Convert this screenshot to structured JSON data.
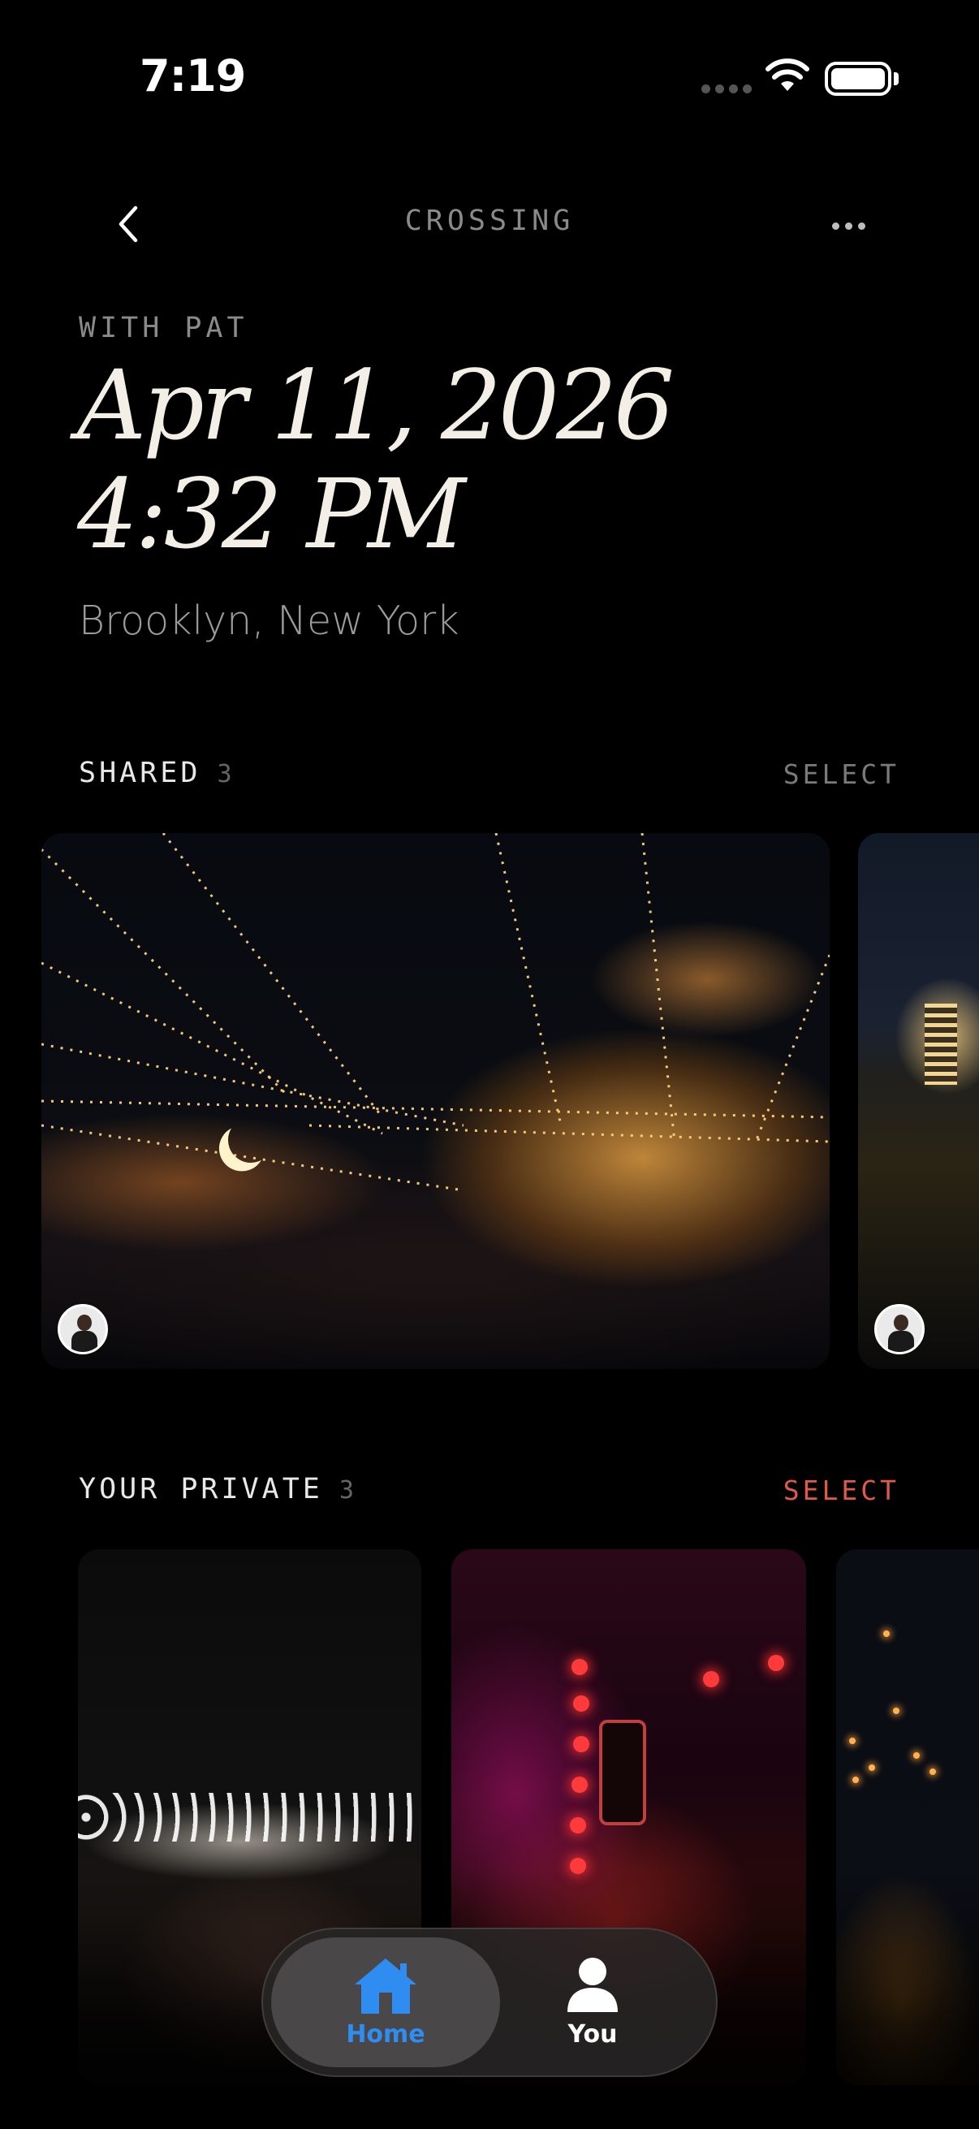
{
  "status_bar": {
    "time": "7:19"
  },
  "nav": {
    "title": "CROSSING"
  },
  "header": {
    "with_label": "WITH PAT",
    "date": "Apr 11, 2026",
    "time": "4:32 PM",
    "location": "Brooklyn, New York"
  },
  "shared": {
    "title": "SHARED",
    "count": "3",
    "select_label": "SELECT"
  },
  "private": {
    "title": "YOUR PRIVATE",
    "count": "3",
    "select_label": "SELECT"
  },
  "tabbar": {
    "tabs": [
      {
        "label": "Home",
        "icon": "home-icon",
        "selected": true
      },
      {
        "label": "You",
        "icon": "person-icon",
        "selected": false
      }
    ]
  },
  "colors": {
    "accent_blue": "#2f8cf0",
    "select_red": "#e05a4a",
    "muted_gray": "#8a8a8a",
    "date_cream": "#f3efe6"
  }
}
